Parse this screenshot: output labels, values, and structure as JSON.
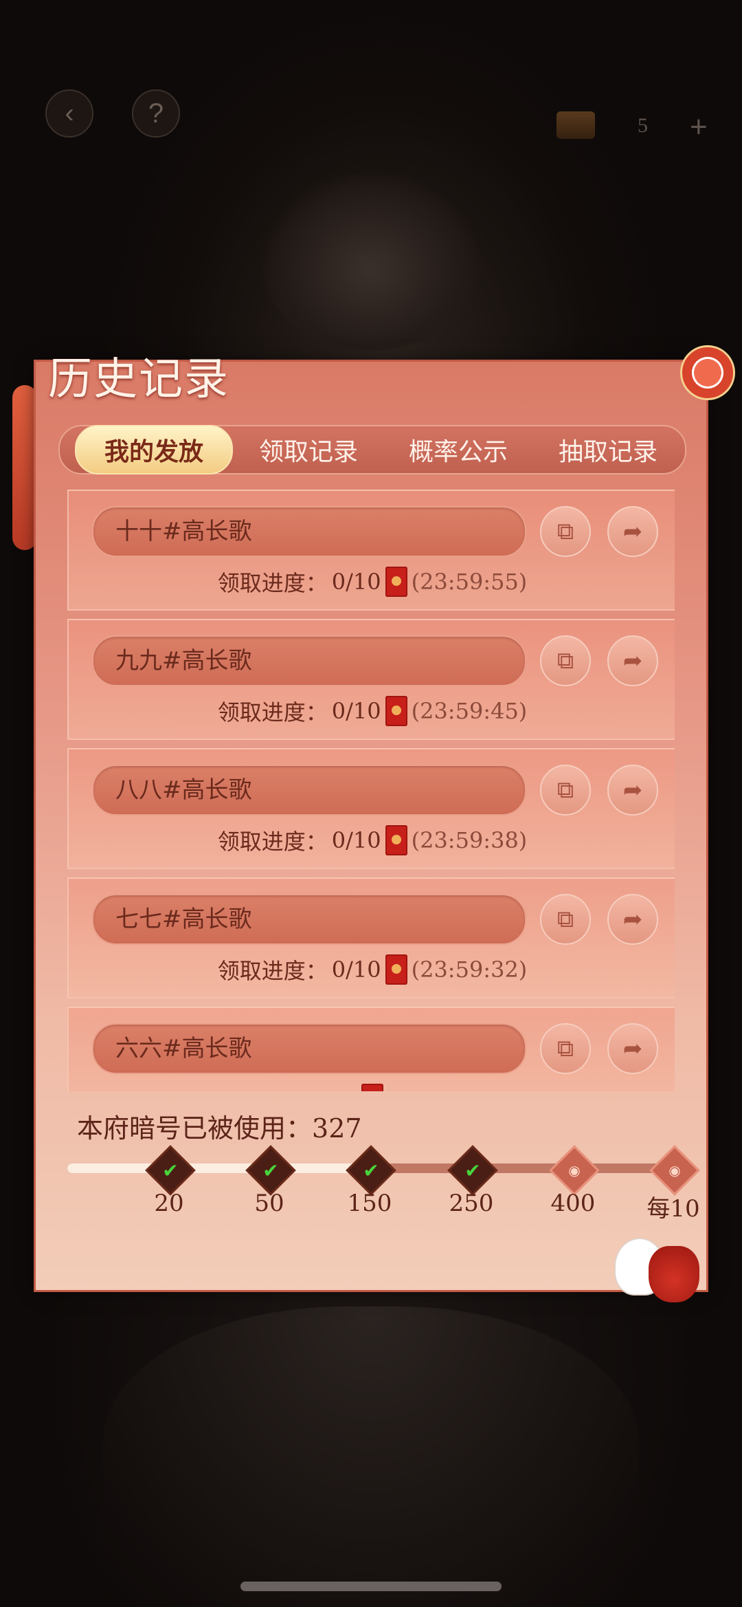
{
  "top_bar": {
    "back_icon": "back-arrow-icon",
    "help_label": "?",
    "currency_icon": "chest-icon",
    "currency_count": "5",
    "add_label": "+"
  },
  "panel": {
    "title": "历史记录",
    "tabs": [
      {
        "label": "我的发放",
        "active": true
      },
      {
        "label": "领取记录",
        "active": false
      },
      {
        "label": "概率公示",
        "active": false
      },
      {
        "label": "抽取记录",
        "active": false
      }
    ]
  },
  "records": [
    {
      "name": "十十#高长歌",
      "progress_label": "领取进度：",
      "progress_value": "0/10",
      "timer": "(23:59:55)"
    },
    {
      "name": "九九#高长歌",
      "progress_label": "领取进度：",
      "progress_value": "0/10",
      "timer": "(23:59:45)"
    },
    {
      "name": "八八#高长歌",
      "progress_label": "领取进度：",
      "progress_value": "0/10",
      "timer": "(23:59:38)"
    },
    {
      "name": "七七#高长歌",
      "progress_label": "领取进度：",
      "progress_value": "0/10",
      "timer": "(23:59:32)"
    },
    {
      "name": "六六#高长歌",
      "progress_label": "",
      "progress_value": "",
      "timer": ""
    }
  ],
  "record_actions": {
    "copy_icon": "copy-icon",
    "share_icon": "share-icon"
  },
  "usage": {
    "label": "本府暗号已被使用：",
    "value": "327",
    "progress_fraction": 0.49,
    "milestones": [
      {
        "label": "20",
        "reached": true
      },
      {
        "label": "50",
        "reached": true
      },
      {
        "label": "150",
        "reached": true
      },
      {
        "label": "250",
        "reached": true
      },
      {
        "label": "400",
        "reached": false
      },
      {
        "label": "每10",
        "reached": false
      }
    ]
  },
  "colors": {
    "panel_top": "#d97a66",
    "panel_bottom": "#f2cdb8",
    "accent_gold": "#f3cc82",
    "text_dark": "#6b2a1c",
    "check_green": "#48d43c"
  }
}
